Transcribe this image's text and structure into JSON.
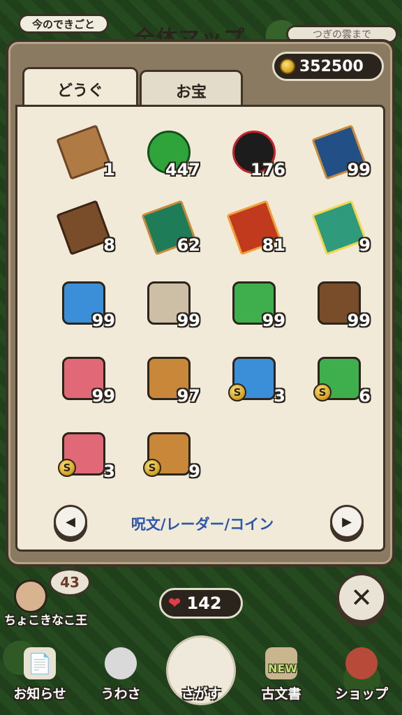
{
  "header": {
    "news_label": "今のできごと",
    "map_title": "全体マップ",
    "next_label": "つぎの雲まで"
  },
  "panel": {
    "tabs": [
      {
        "label": "どうぐ",
        "active": true
      },
      {
        "label": "お宝",
        "active": false
      }
    ],
    "coins": "352500",
    "category_label": "呪文/レーダー/コイン",
    "prev_button": "◀",
    "next_button": "▶"
  },
  "items": [
    {
      "icon": "spellbook-icon",
      "count": "1",
      "coin": false
    },
    {
      "icon": "green-orb-icon",
      "count": "447",
      "coin": false
    },
    {
      "icon": "black-face-orb-icon",
      "count": "176",
      "coin": false
    },
    {
      "icon": "blue-scroll-icon",
      "count": "99",
      "coin": false
    },
    {
      "icon": "fist-scroll-icon",
      "count": "8",
      "coin": false
    },
    {
      "icon": "wind-scroll-icon",
      "count": "62",
      "coin": false
    },
    {
      "icon": "fire-scroll-icon",
      "count": "81",
      "coin": false
    },
    {
      "icon": "star-scroll-icon",
      "count": "9",
      "coin": false
    },
    {
      "icon": "radar-boy-icon",
      "count": "99",
      "coin": false
    },
    {
      "icon": "radar-animal-icon",
      "count": "99",
      "coin": false
    },
    {
      "icon": "radar-tree-icon",
      "count": "99",
      "coin": false
    },
    {
      "icon": "radar-chest-icon",
      "count": "99",
      "coin": false
    },
    {
      "icon": "radar-fairy-icon",
      "count": "99",
      "coin": false
    },
    {
      "icon": "radar-mound-icon",
      "count": "97",
      "coin": false
    },
    {
      "icon": "radar-boy-coin-icon",
      "count": "3",
      "coin": true
    },
    {
      "icon": "radar-tree-coin-icon",
      "count": "6",
      "coin": true
    },
    {
      "icon": "radar-fairy-coin-icon",
      "count": "3",
      "coin": true
    },
    {
      "icon": "radar-mound-coin-icon",
      "count": "9",
      "coin": true
    }
  ],
  "player": {
    "level": "43",
    "name": "ちょこきなこ王",
    "hearts": "142"
  },
  "close_label": "✕",
  "bottom_nav": [
    {
      "label": "お知らせ",
      "icon": "notice-icon"
    },
    {
      "label": "うわさ",
      "icon": "speech-bubble-icon"
    },
    {
      "label": "さがす",
      "icon": "search-treasure-icon"
    },
    {
      "label": "古文書",
      "icon": "scroll-icon",
      "badge": "NEW"
    },
    {
      "label": "ショップ",
      "icon": "shop-icon"
    }
  ],
  "colors": {
    "panel_border": "#3e3326",
    "paper": "#f1ead9",
    "category_text": "#2c56a6",
    "coin_gold": "#d7a82a"
  }
}
